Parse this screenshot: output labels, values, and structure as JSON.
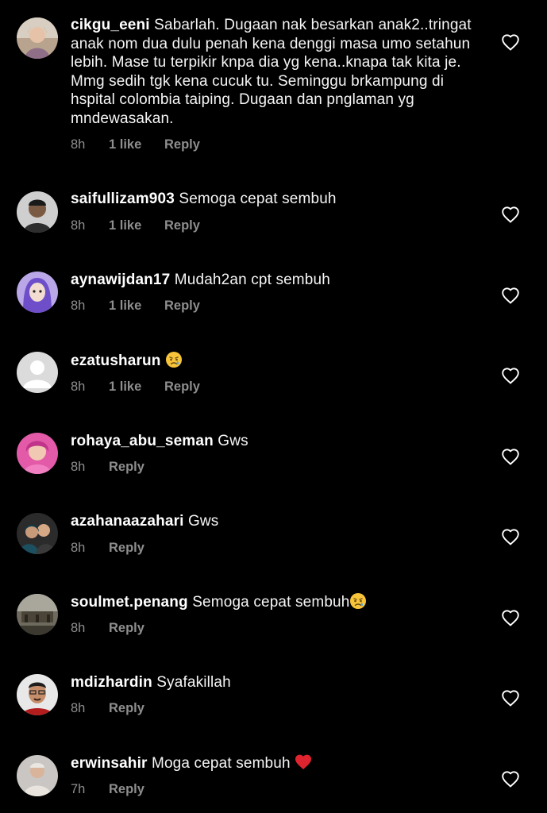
{
  "comments": [
    {
      "username": "cikgu_eeni",
      "text": "Sabarlah. Dugaan nak besarkan anak2..tringat anak nom dua dulu penah kena denggi masa umo setahun lebih. Mase tu terpikir knpa dia yg kena..knapa tak kita je. Mmg sedih tgk kena cucuk tu. Seminggu brkampung di hspital colombia taiping. Dugaan dan pnglaman yg mndewasakan.",
      "time": "8h",
      "likes": "1 like",
      "reply": "Reply",
      "avatar_icon": "profile-photo"
    },
    {
      "username": "saifullizam903",
      "text": "Semoga cepat sembuh",
      "time": "8h",
      "likes": "1 like",
      "reply": "Reply",
      "avatar_icon": "profile-photo"
    },
    {
      "username": "aynawijdan17",
      "text": "Mudah2an cpt sembuh",
      "time": "8h",
      "likes": "1 like",
      "reply": "Reply",
      "avatar_icon": "cartoon-profile-photo"
    },
    {
      "username": "ezatusharun",
      "text": "",
      "emoji": "crying-face-emoji",
      "time": "8h",
      "likes": "1 like",
      "reply": "Reply",
      "avatar_icon": "default-avatar"
    },
    {
      "username": "rohaya_abu_seman",
      "text": "Gws",
      "time": "8h",
      "reply": "Reply",
      "avatar_icon": "profile-photo"
    },
    {
      "username": "azahanaazahari",
      "text": "Gws",
      "time": "8h",
      "reply": "Reply",
      "avatar_icon": "profile-photo"
    },
    {
      "username": "soulmet.penang",
      "text": "Semoga cepat sembuh",
      "emoji": "crying-face-emoji",
      "time": "8h",
      "reply": "Reply",
      "avatar_icon": "profile-photo"
    },
    {
      "username": "mdizhardin",
      "text": "Syafakillah",
      "time": "8h",
      "reply": "Reply",
      "avatar_icon": "profile-photo"
    },
    {
      "username": "erwinsahir",
      "text": "Moga cepat sembuh ",
      "emoji": "red-heart-emoji",
      "time": "7h",
      "reply": "Reply",
      "avatar_icon": "profile-photo"
    }
  ],
  "icons": {
    "like": "heart-outline-icon"
  },
  "colors": {
    "background": "#000000",
    "text": "#ffffff",
    "secondary": "#8e8e8e"
  }
}
